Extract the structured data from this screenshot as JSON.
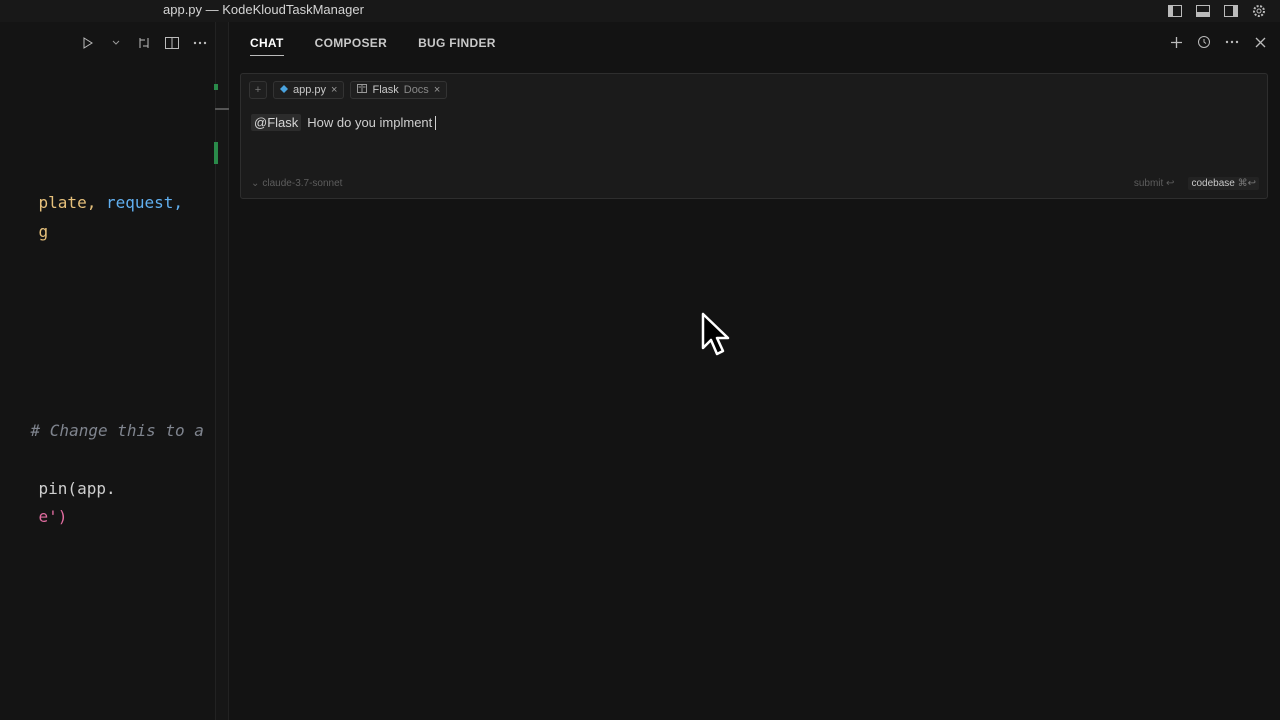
{
  "window": {
    "title": "app.py — KodeKloudTaskManager"
  },
  "editor": {
    "lines": [
      {
        "text": "plate, ",
        "color": "#e6c07b"
      },
      {
        "text": "request,",
        "color": "#61afef"
      },
      {
        "text": "g",
        "color": "#e6c07b"
      },
      {
        "text": "# Change this to a",
        "color": "#7f848e"
      },
      {
        "text": "pin(app.",
        "color": "#cfcfcf"
      },
      {
        "text": "e')",
        "color": "#e06c9f"
      }
    ]
  },
  "chat": {
    "tabs": [
      {
        "label": "CHAT",
        "active": true
      },
      {
        "label": "COMPOSER",
        "active": false
      },
      {
        "label": "BUG FINDER",
        "active": false
      }
    ],
    "context_chips": [
      {
        "label": "app.py",
        "icon": "python-file-icon"
      },
      {
        "label": "Flask",
        "sub": "Docs",
        "icon": "docs-icon"
      }
    ],
    "add_chip": "+",
    "mention": "@Flask",
    "prompt_text": "How do you implment",
    "model": "claude-3.7-sonnet",
    "submit_label": "submit ↩",
    "codebase_label": "codebase",
    "codebase_shortcut": "⌘↩"
  },
  "colors": {
    "accent_green": "#2a8a4a",
    "bg": "#131313"
  }
}
